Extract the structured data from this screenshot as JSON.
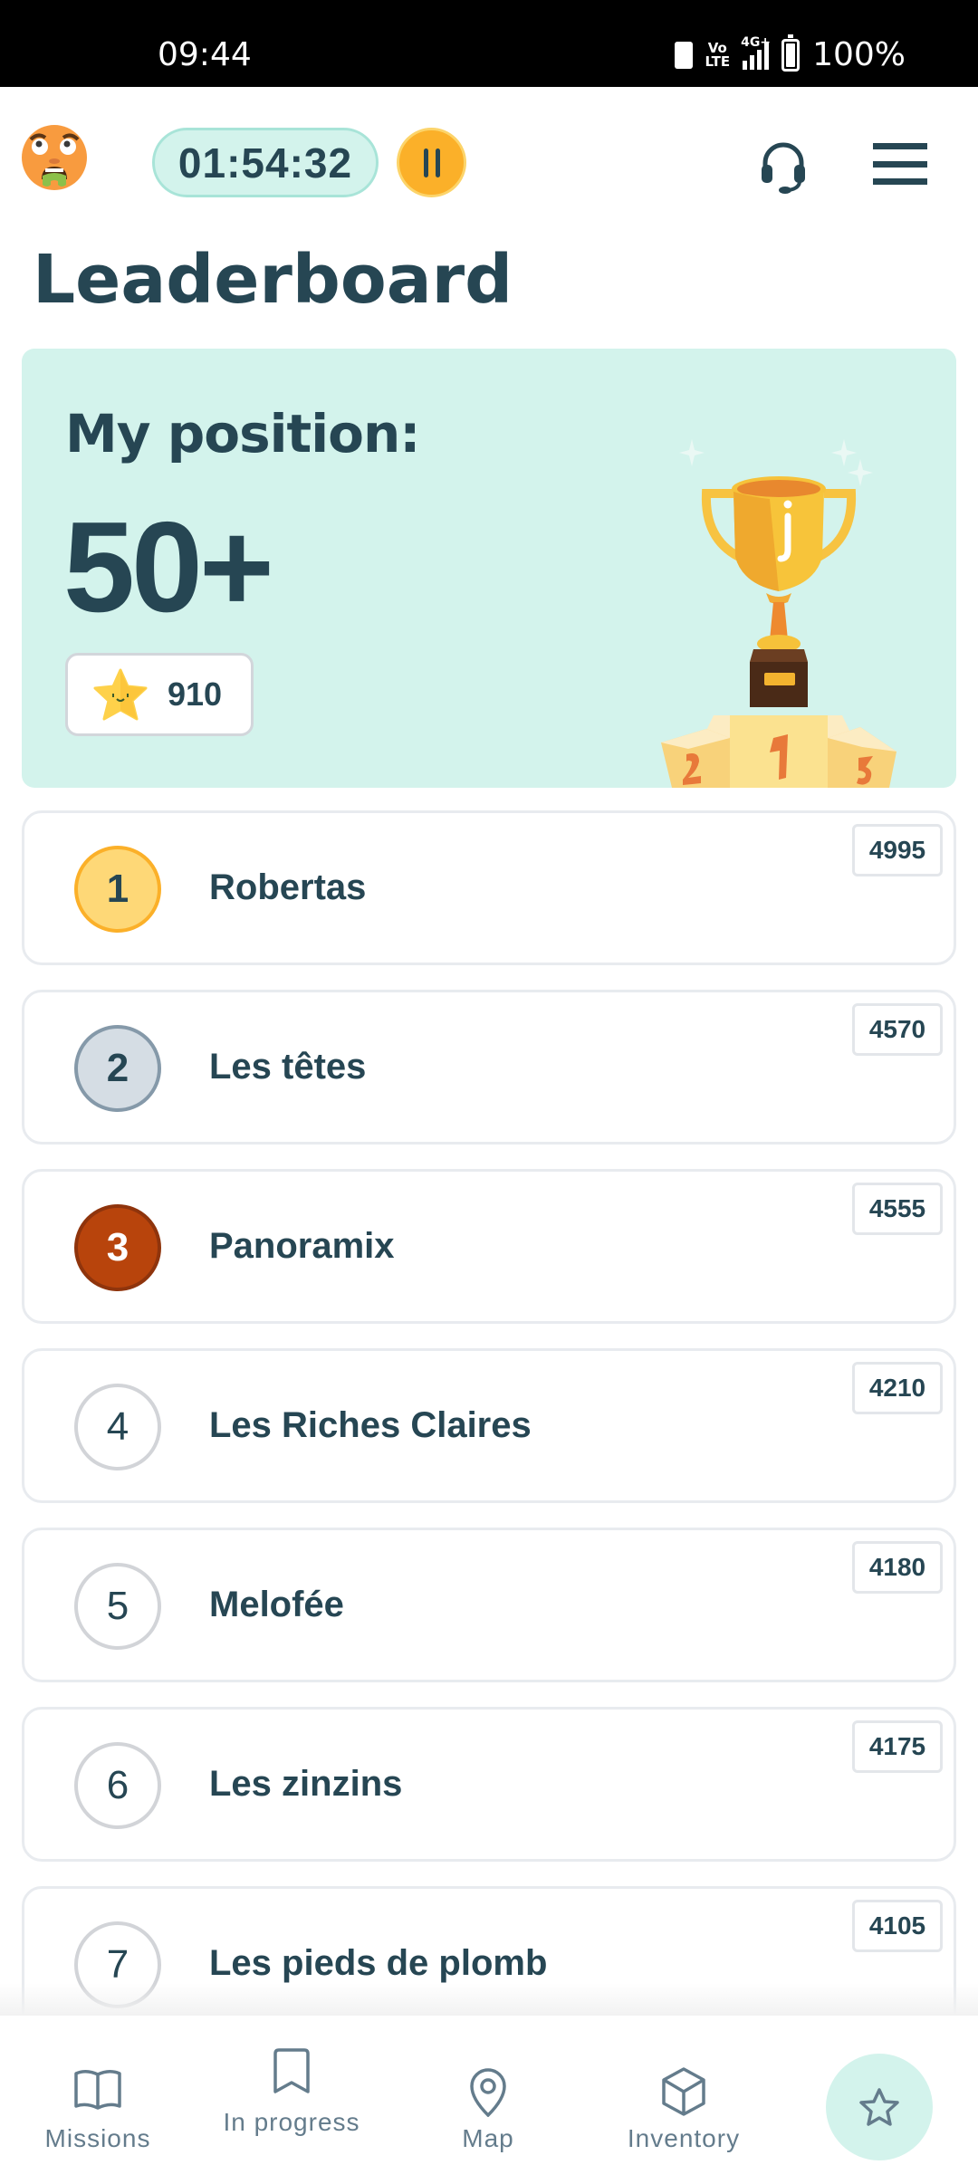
{
  "status_bar": {
    "time": "09:44",
    "network": "4G+",
    "volte": "Vo LTE",
    "battery": "100%"
  },
  "header": {
    "avatar_icon": "nauseated-face-emoji",
    "timer": "01:54:32",
    "pause_icon": "pause-icon",
    "support_icon": "headset-icon",
    "menu_icon": "hamburger-menu-icon"
  },
  "page_title": "Leaderboard",
  "my_position": {
    "label": "My position:",
    "value": "50+",
    "points": "910",
    "points_icon": "star-icon",
    "illustration": "trophy-podium"
  },
  "leaderboard": [
    {
      "rank": "1",
      "name": "Robertas",
      "score": "4995",
      "medal": "gold"
    },
    {
      "rank": "2",
      "name": "Les têtes",
      "score": "4570",
      "medal": "silver"
    },
    {
      "rank": "3",
      "name": "Panoramix",
      "score": "4555",
      "medal": "bronze"
    },
    {
      "rank": "4",
      "name": "Les Riches Claires",
      "score": "4210",
      "medal": "none"
    },
    {
      "rank": "5",
      "name": "Melofée",
      "score": "4180",
      "medal": "none"
    },
    {
      "rank": "6",
      "name": "Les zinzins",
      "score": "4175",
      "medal": "none"
    },
    {
      "rank": "7",
      "name": "Les pieds de plomb",
      "score": "4105",
      "medal": "none"
    }
  ],
  "bottom_nav": {
    "items": [
      {
        "label": "Missions",
        "icon": "book-open-icon"
      },
      {
        "label": "In progress",
        "icon": "bookmark-icon"
      },
      {
        "label": "Map",
        "icon": "map-pin-icon"
      },
      {
        "label": "Inventory",
        "icon": "cube-icon"
      },
      {
        "label": "",
        "icon": "star-icon",
        "active": true
      }
    ]
  },
  "colors": {
    "primary_text": "#264653",
    "mint": "#d3f3ec",
    "accent_orange": "#fbb029",
    "gold": "#fed877",
    "silver": "#d5dde4",
    "bronze": "#b8440c",
    "nav_icon": "#647c8c"
  }
}
